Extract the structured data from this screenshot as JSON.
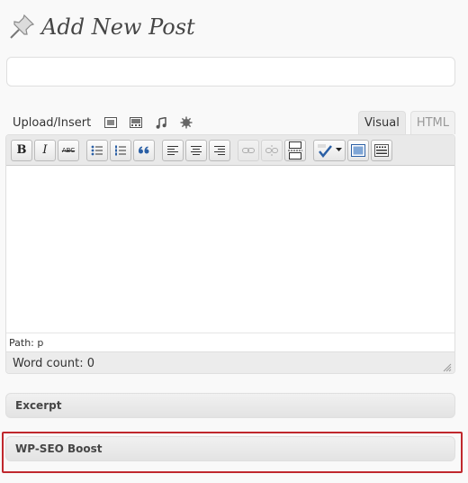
{
  "header": {
    "title": "Add New Post",
    "icon": "pushpin-icon"
  },
  "title_input": {
    "value": "",
    "placeholder": ""
  },
  "media": {
    "label": "Upload/Insert",
    "icons": [
      "image-icon",
      "video-icon",
      "audio-icon",
      "media-icon"
    ]
  },
  "tabs": {
    "visual": "Visual",
    "html": "HTML",
    "active": "Visual"
  },
  "toolbar": {
    "bold": "B",
    "italic": "I",
    "strike": "ABC"
  },
  "editor": {
    "path_label": "Path: p",
    "word_count_label": "Word count: 0"
  },
  "boxes": {
    "excerpt": "Excerpt",
    "wpseo": "WP-SEO Boost"
  },
  "colors": {
    "highlight": "#c0282d",
    "toolbar_bg": "#e9e9e9",
    "blue_icon": "#2a5fa5"
  }
}
